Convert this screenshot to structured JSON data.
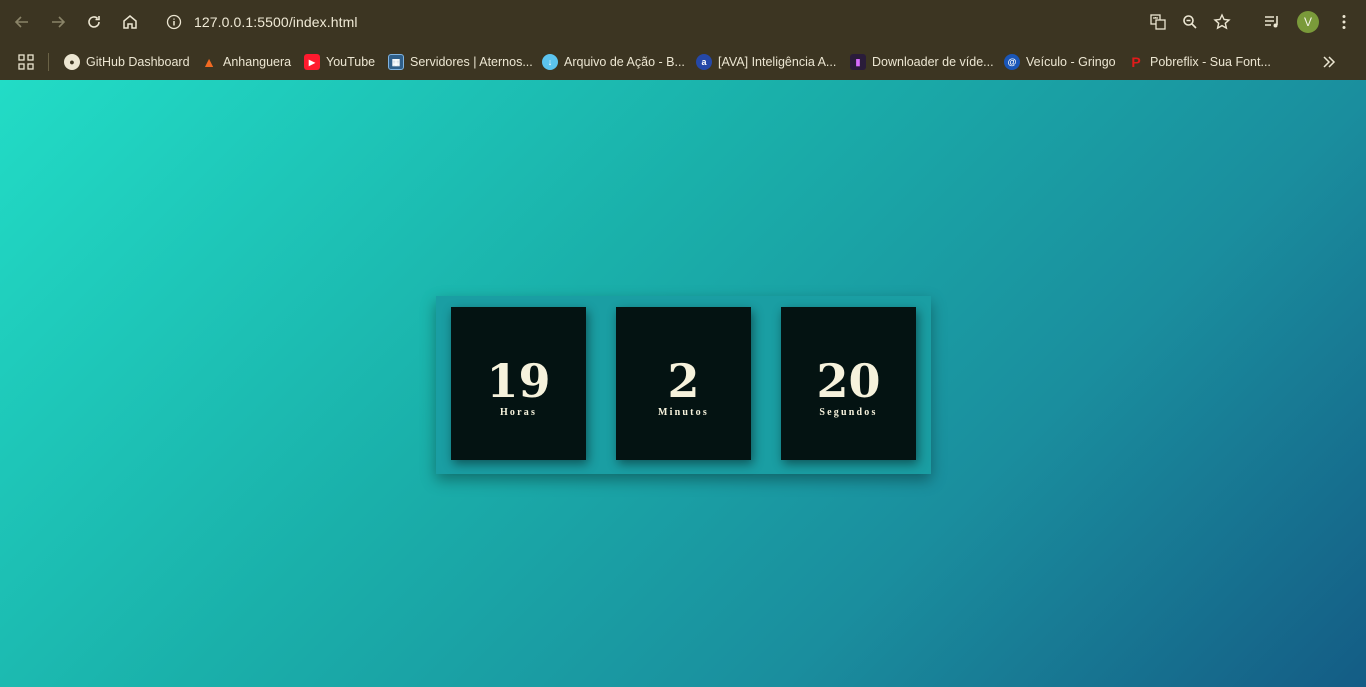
{
  "browser": {
    "url": "127.0.0.1:5500/index.html",
    "avatar_letter": "V"
  },
  "bookmarks": [
    {
      "label": "GitHub Dashboard",
      "icon": "github-icon"
    },
    {
      "label": "Anhanguera",
      "icon": "anhanguera-icon"
    },
    {
      "label": "YouTube",
      "icon": "youtube-icon"
    },
    {
      "label": "Servidores | Aternos...",
      "icon": "aternos-icon"
    },
    {
      "label": "Arquivo de Ação - B...",
      "icon": "arquivo-icon"
    },
    {
      "label": "[AVA] Inteligência A...",
      "icon": "ava-icon"
    },
    {
      "label": "Downloader de víde...",
      "icon": "downloader-icon"
    },
    {
      "label": "Veículo - Gringo",
      "icon": "gringo-icon"
    },
    {
      "label": "Pobreflix - Sua Font...",
      "icon": "pobreflix-icon"
    }
  ],
  "countdown": {
    "hours": {
      "value": "19",
      "label": "Horas"
    },
    "minutes": {
      "value": "2",
      "label": "Minutos"
    },
    "seconds": {
      "value": "20",
      "label": "Segundos"
    }
  },
  "colors": {
    "gradient_start": "#22dcc6",
    "gradient_end": "#145c85",
    "box_bg": "#041312",
    "text": "#f6f2dc"
  }
}
